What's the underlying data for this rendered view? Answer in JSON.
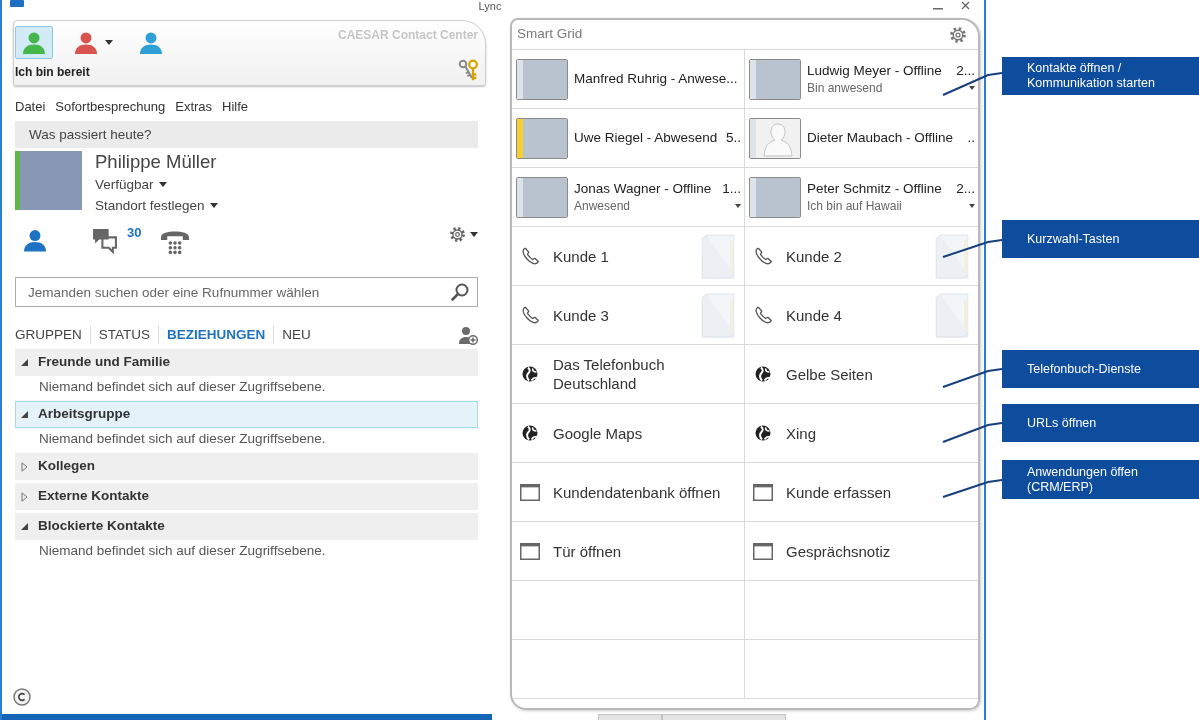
{
  "window": {
    "title": "Lync"
  },
  "status_panel": {
    "buttons": [
      {
        "color": "#45b649",
        "selected": true,
        "dropdown": false
      },
      {
        "color": "#d9534f",
        "selected": false,
        "dropdown": true
      },
      {
        "color": "#2f9fd8",
        "selected": false,
        "dropdown": false
      }
    ],
    "status_text": "Ich bin bereit",
    "brand": "CAESAR Contact Center"
  },
  "menu": [
    "Datei",
    "Sofortbesprechung",
    "Extras",
    "Hilfe"
  ],
  "note_field": {
    "placeholder": "Was passiert heute?"
  },
  "profile": {
    "name": "Philippe Müller",
    "available": true,
    "availability": "Verfügbar",
    "location": "Standort festlegen"
  },
  "views": [
    {
      "kind": "contacts",
      "selected": true
    },
    {
      "kind": "conversations",
      "selected": false,
      "badge": "30"
    },
    {
      "kind": "phone",
      "selected": false
    }
  ],
  "search": {
    "placeholder": "Jemanden suchen oder eine Rufnummer wählen"
  },
  "tabs": [
    {
      "label": "GRUPPEN",
      "selected": false
    },
    {
      "label": "STATUS",
      "selected": false
    },
    {
      "label": "BEZIEHUNGEN",
      "selected": true
    },
    {
      "label": "NEU",
      "selected": false
    }
  ],
  "groups": [
    {
      "name": "Freunde und Familie",
      "expanded": true,
      "selected": false,
      "empty_message": "Niemand befindet sich auf dieser Zugriffsebene."
    },
    {
      "name": "Arbeitsgruppe",
      "expanded": true,
      "selected": true,
      "empty_message": "Niemand befindet sich auf dieser Zugriffsebene."
    },
    {
      "name": "Kollegen",
      "expanded": false,
      "selected": false
    },
    {
      "name": "Externe Kontakte",
      "expanded": false,
      "selected": false
    },
    {
      "name": "Blockierte Kontakte",
      "expanded": true,
      "selected": false,
      "empty_message": "Niemand befindet sich auf dieser Zugriffsebene."
    }
  ],
  "smart_grid": {
    "title": "Smart Grid",
    "cells": [
      {
        "kind": "contact",
        "title": "Manfred Ruhrig - Anwese...",
        "color": "#dde3e8",
        "photo": true,
        "menu": false
      },
      {
        "kind": "contact",
        "title": "Ludwig Meyer - Offline",
        "extra": "2...",
        "note": "Bin anwesend",
        "color": "#dde3e8",
        "photo": true,
        "menu": true
      },
      {
        "kind": "contact",
        "title": "Uwe Riegel - Abwesend",
        "extra": "5..",
        "color": "#f7cf2e",
        "photo": true,
        "menu": false
      },
      {
        "kind": "contact",
        "title": "Dieter Maubach - Offline",
        "extra": "..",
        "color": "#dde3e8",
        "photo": false,
        "menu": false
      },
      {
        "kind": "contact",
        "title": "Jonas Wagner - Offline",
        "extra": "1...",
        "note": "Anwesend",
        "color": "#dde3e8",
        "photo": true,
        "menu": true
      },
      {
        "kind": "contact",
        "title": "Peter Schmitz - Offline",
        "extra": "2...",
        "note": "Ich bin auf Hawaii",
        "color": "#dde3e8",
        "photo": true,
        "menu": true
      },
      {
        "kind": "speed_dial",
        "label": "Kunde 1"
      },
      {
        "kind": "speed_dial",
        "label": "Kunde 2"
      },
      {
        "kind": "speed_dial",
        "label": "Kunde 3"
      },
      {
        "kind": "speed_dial",
        "label": "Kunde 4"
      },
      {
        "kind": "web",
        "label": "Das Telefonbuch Deutschland"
      },
      {
        "kind": "web",
        "label": "Gelbe Seiten"
      },
      {
        "kind": "web",
        "label": "Google Maps"
      },
      {
        "kind": "web",
        "label": "Xing"
      },
      {
        "kind": "app",
        "label": "Kundendatenbank öffnen"
      },
      {
        "kind": "app",
        "label": "Kunde erfassen"
      },
      {
        "kind": "app",
        "label": "Tür öffnen"
      },
      {
        "kind": "app",
        "label": "Gesprächsnotiz"
      },
      {
        "kind": "empty"
      },
      {
        "kind": "empty"
      },
      {
        "kind": "empty"
      },
      {
        "kind": "empty"
      }
    ]
  },
  "callouts": [
    {
      "label": "Kontakte öffnen /\nKommunikation starten"
    },
    {
      "label": "Kurzwahl-Tasten"
    },
    {
      "label": "Telefonbuch-Dienste"
    },
    {
      "label": "URLs öffnen"
    },
    {
      "label": "Anwendungen öffen\n(CRM/ERP)"
    }
  ]
}
